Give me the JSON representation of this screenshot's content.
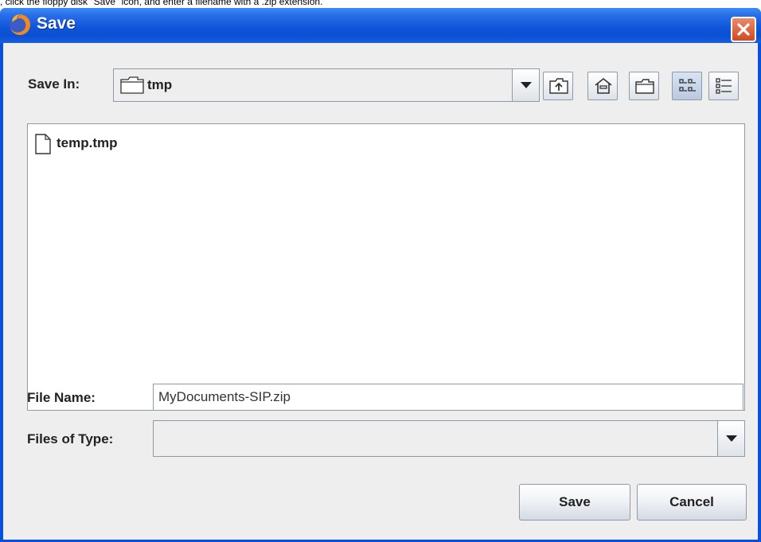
{
  "caption": ", click the floppy disk \"Save\" icon, and enter a filename with a .zip extension.",
  "window": {
    "title": "Save",
    "icon": "firefox-icon",
    "close_icon": "close-icon"
  },
  "save_in": {
    "label": "Save In:",
    "value": "tmp",
    "icon": "folder-icon"
  },
  "toolbar": {
    "buttons": [
      {
        "name": "up-one-level-icon"
      },
      {
        "name": "home-icon"
      },
      {
        "name": "new-folder-icon"
      },
      {
        "name": "list-view-icon",
        "selected": true
      },
      {
        "name": "details-view-icon"
      }
    ]
  },
  "files": [
    {
      "name": "temp.tmp",
      "icon": "file-icon"
    }
  ],
  "file_name": {
    "label": "File Name:",
    "value": "MyDocuments-SIP.zip"
  },
  "files_of_type": {
    "label": "Files of Type:",
    "value": ""
  },
  "buttons": {
    "save": "Save",
    "cancel": "Cancel"
  }
}
